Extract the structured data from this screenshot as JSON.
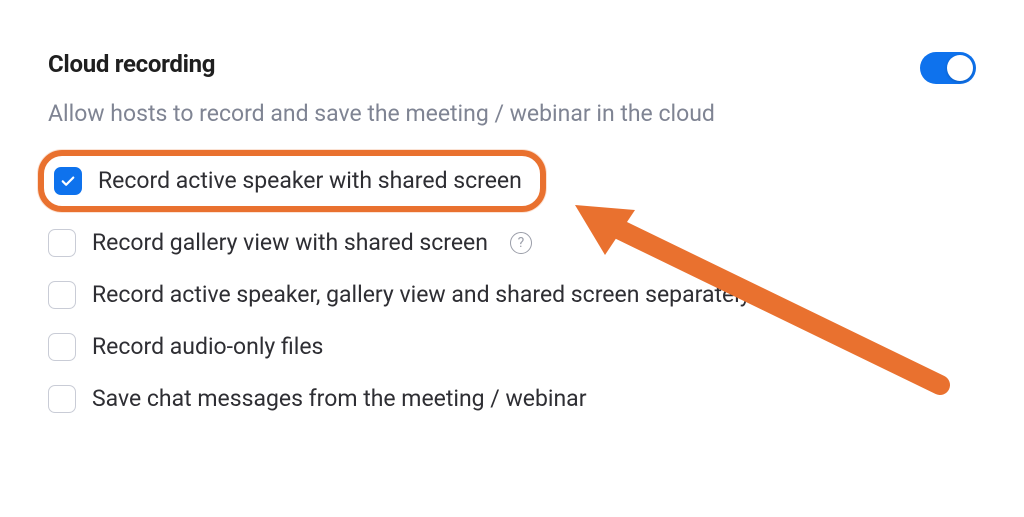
{
  "section": {
    "title": "Cloud recording",
    "description": "Allow hosts to record and save the meeting / webinar in the cloud",
    "toggle_on": true
  },
  "options": [
    {
      "label": "Record active speaker with shared screen",
      "checked": true,
      "highlighted": true,
      "help": false
    },
    {
      "label": "Record gallery view with shared screen",
      "checked": false,
      "highlighted": false,
      "help": true
    },
    {
      "label": "Record active speaker, gallery view and shared screen separately",
      "checked": false,
      "highlighted": false,
      "help": false
    },
    {
      "label": "Record audio-only files",
      "checked": false,
      "highlighted": false,
      "help": false
    },
    {
      "label": "Save chat messages from the meeting / webinar",
      "checked": false,
      "highlighted": false,
      "help": false
    }
  ],
  "colors": {
    "accent": "#0e72ed",
    "highlight": "#e9712f"
  }
}
